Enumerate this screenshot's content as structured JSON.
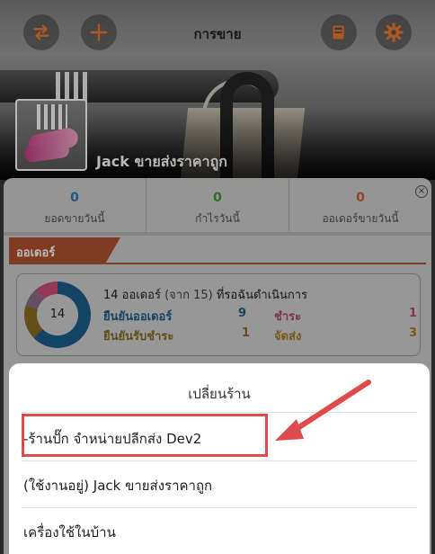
{
  "header": {
    "title": "การขาย",
    "shop_name": "Jack ขายส่งราคาถูก"
  },
  "stats": [
    {
      "value": "0",
      "label": "ยอดขายวันนี้",
      "color": "#2b78b8"
    },
    {
      "value": "0",
      "label": "กำไรวันนี้",
      "color": "#3a9b3a"
    },
    {
      "value": "0",
      "label": "ออเดอร์ขายวันนี้",
      "color": "#c9602e"
    }
  ],
  "orders": {
    "tab_label": "ออเดอร์",
    "donut_total": "14",
    "summary_main": "14 ออเดอร์",
    "summary_sub": "(จาก 15)",
    "summary_tail": "ที่รอฉันดำเนินการ",
    "rows": [
      {
        "label": "ยืนยันออเดอร์",
        "value": "9",
        "color": "#1c5f8d"
      },
      {
        "label": "ยืนยันรับชำระ",
        "value": "1",
        "color": "#8a6d22"
      },
      {
        "label": "ชำระ",
        "value": "1",
        "color": "#b54a6c"
      },
      {
        "label": "จัดส่ง",
        "value": "3",
        "color": "#a87d1c"
      }
    ]
  },
  "sheet": {
    "title": "เปลี่ยนร้าน",
    "items": [
      "-ร้านปั๊ก จำหน่ายปลีกส่ง Dev2",
      "(ใช้งานอยู่) Jack ขายส่งราคาถูก",
      "เครื่องใช้ในบ้าน"
    ]
  },
  "icons": {
    "switch": "switch-arrows-icon",
    "add": "plus-icon",
    "report": "book-icon",
    "settings": "gear-icon",
    "close": "close-icon"
  },
  "colors": {
    "accent": "#f07a30",
    "annotation": "#e04a4a"
  }
}
